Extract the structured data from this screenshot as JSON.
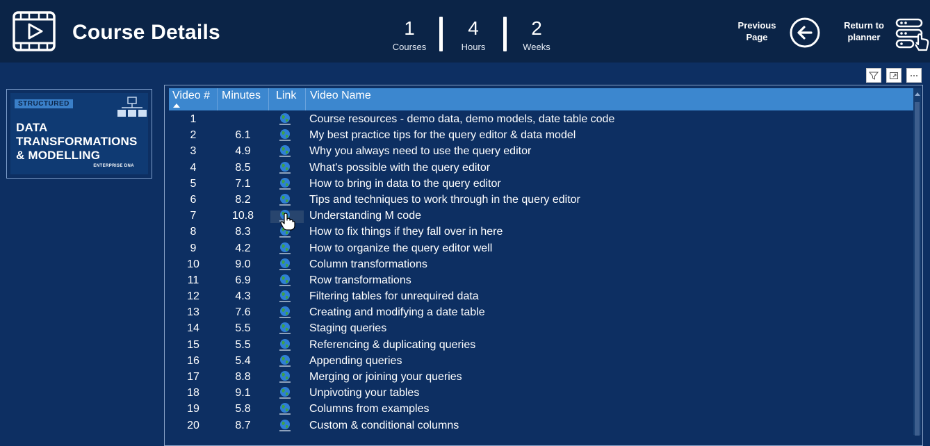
{
  "header": {
    "title": "Course Details",
    "stats": [
      {
        "value": "1",
        "label": "Courses"
      },
      {
        "value": "4",
        "label": "Hours"
      },
      {
        "value": "2",
        "label": "Weeks"
      }
    ],
    "previous_page": "Previous Page",
    "previous_page_line1": "Previous",
    "previous_page_line2": "Page",
    "return_planner_line1": "Return to",
    "return_planner_line2": "planner"
  },
  "course_card": {
    "tag": "STRUCTURED",
    "title_line1": "DATA",
    "title_line2": "TRANSFORMATIONS",
    "title_line3": "& MODELLING",
    "brand": "ENTERPRISE DNA"
  },
  "table": {
    "columns": [
      "Video #",
      "Minutes",
      "Link",
      "Video Name"
    ],
    "rows": [
      {
        "num": "1",
        "minutes": "",
        "name": "Course resources - demo data, demo models, date table code"
      },
      {
        "num": "2",
        "minutes": "6.1",
        "name": "My best practice tips for the query editor & data model"
      },
      {
        "num": "3",
        "minutes": "4.9",
        "name": "Why you always need to use the query editor"
      },
      {
        "num": "4",
        "minutes": "8.5",
        "name": "What's possible with the query editor"
      },
      {
        "num": "5",
        "minutes": "7.1",
        "name": "How to bring in data to the query editor"
      },
      {
        "num": "6",
        "minutes": "8.2",
        "name": "Tips and techniques to work through in the query editor"
      },
      {
        "num": "7",
        "minutes": "10.8",
        "name": "Understanding M code"
      },
      {
        "num": "8",
        "minutes": "8.3",
        "name": "How to fix things if they fall over in here"
      },
      {
        "num": "9",
        "minutes": "4.2",
        "name": "How to organize the query editor well"
      },
      {
        "num": "10",
        "minutes": "9.0",
        "name": "Column transformations"
      },
      {
        "num": "11",
        "minutes": "6.9",
        "name": "Row transformations"
      },
      {
        "num": "12",
        "minutes": "4.3",
        "name": "Filtering tables for unrequired data"
      },
      {
        "num": "13",
        "minutes": "7.6",
        "name": "Creating and modifying a date table"
      },
      {
        "num": "14",
        "minutes": "5.5",
        "name": "Staging queries"
      },
      {
        "num": "15",
        "minutes": "5.5",
        "name": "Referencing & duplicating queries"
      },
      {
        "num": "16",
        "minutes": "5.4",
        "name": "Appending queries"
      },
      {
        "num": "17",
        "minutes": "8.8",
        "name": "Merging or joining your queries"
      },
      {
        "num": "18",
        "minutes": "9.1",
        "name": "Unpivoting your tables"
      },
      {
        "num": "19",
        "minutes": "5.8",
        "name": "Columns from examples"
      },
      {
        "num": "20",
        "minutes": "8.7",
        "name": "Custom & conditional columns"
      }
    ]
  },
  "visual_toolbar": [
    "filter-icon",
    "focus-mode-icon",
    "more-options-icon"
  ],
  "colors": {
    "background": "#0d2f62",
    "header_bg": "#0b2447",
    "table_header": "#3c87cf"
  }
}
